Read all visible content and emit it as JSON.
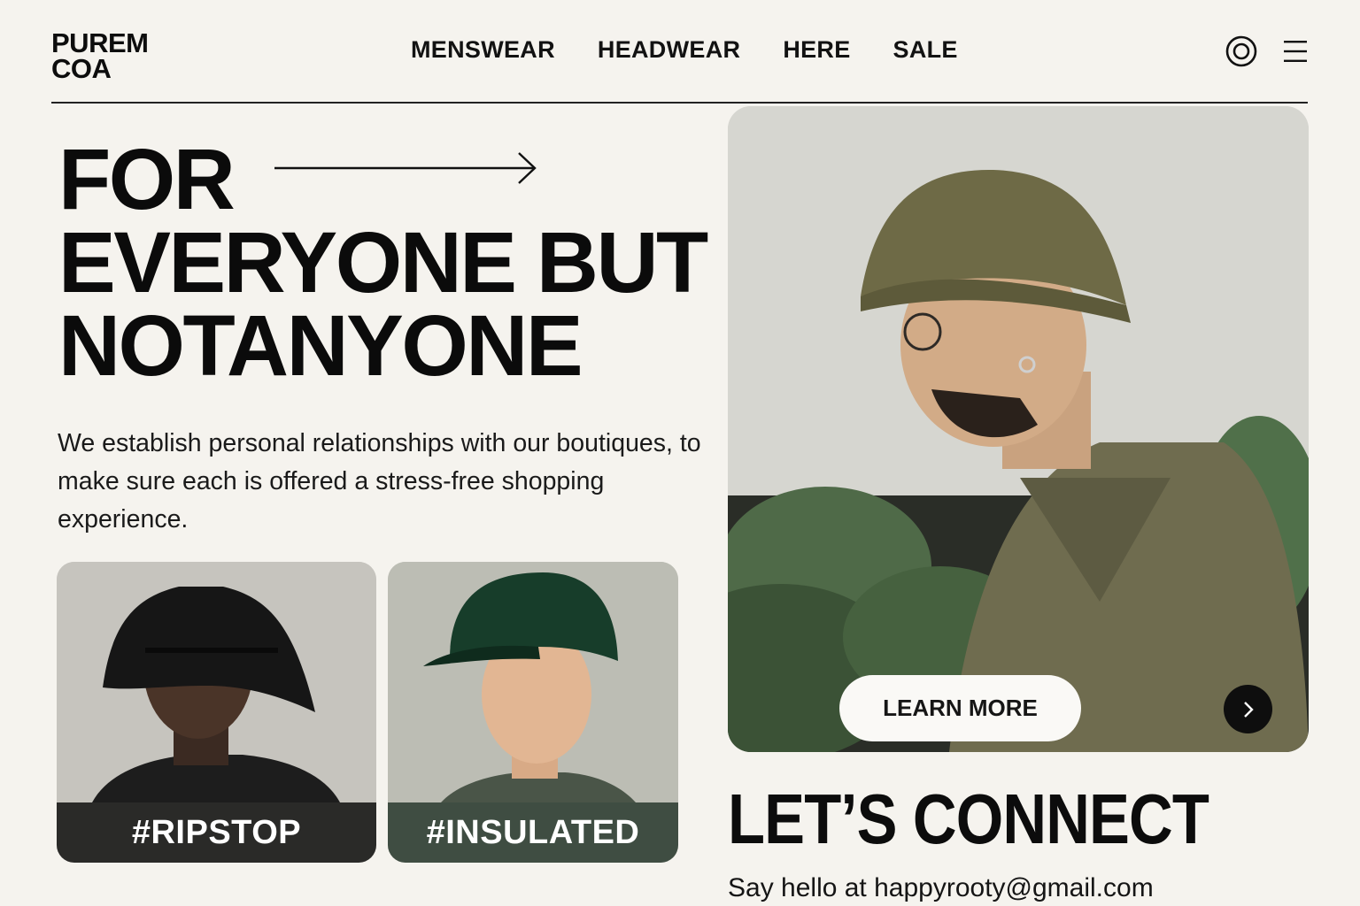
{
  "brand": {
    "line1": "PUREM",
    "line2": "COA"
  },
  "nav": {
    "items": [
      {
        "label": "MENSWEAR"
      },
      {
        "label": "HEADWEAR"
      },
      {
        "label": "HERE"
      },
      {
        "label": "SALE"
      }
    ]
  },
  "header_icons": {
    "left": "target-icon",
    "right": "menu-icon"
  },
  "hero": {
    "line1": "FOR",
    "line2": "EVERYONE BUT",
    "line3": "NOTANYONE",
    "description": "We establish personal relationships with our boutiques, to make sure each is offered a stress-free shopping experience."
  },
  "cards": [
    {
      "tag": "#RIPSTOP",
      "tag_color": "#2a2a28"
    },
    {
      "tag": "#INSULATED",
      "tag_color": "#3f4d42"
    }
  ],
  "feature": {
    "cta_label": "LEARN MORE",
    "next_icon": "chevron-right-icon"
  },
  "connect": {
    "title": "LET’S CONNECT",
    "prefix": "Say hello at ",
    "email": "happyrooty@gmail.com"
  },
  "colors": {
    "background": "#f5f3ee",
    "text": "#111111",
    "accent_dark": "#0e0e0e",
    "olive": "#6b6a4c"
  }
}
